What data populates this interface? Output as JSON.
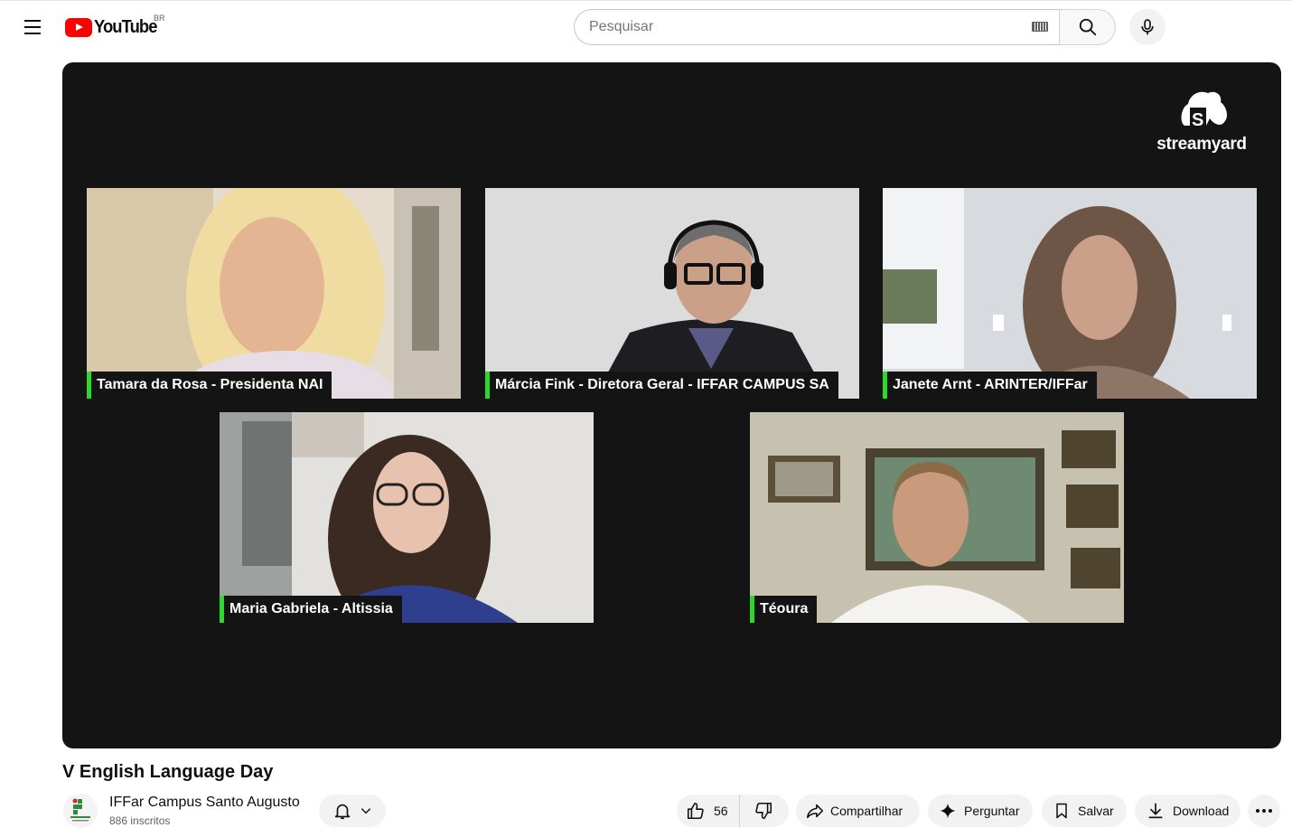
{
  "header": {
    "logo_text": "YouTube",
    "country_code": "BR",
    "search_placeholder": "Pesquisar"
  },
  "player": {
    "watermark": "streamyard",
    "participants": [
      {
        "name": "Tamara da Rosa - Presidenta NAI"
      },
      {
        "name": "Márcia Fink - Diretora Geral - IFFAR CAMPUS SA"
      },
      {
        "name": "Janete Arnt - ARINTER/IFFar"
      },
      {
        "name": "Maria Gabriela - Altissia"
      },
      {
        "name": "Téoura"
      }
    ]
  },
  "video": {
    "title": "V English Language Day",
    "channel_name": "IFFar Campus Santo Augusto",
    "subscribers": "886 inscritos"
  },
  "actions": {
    "like_count": "56",
    "share_label": "Compartilhar",
    "ask_label": "Perguntar",
    "save_label": "Salvar",
    "download_label": "Download"
  },
  "colors": {
    "brand_red": "#ff0000",
    "nameplate_accent": "#2bd82b",
    "player_bg": "#151414"
  }
}
